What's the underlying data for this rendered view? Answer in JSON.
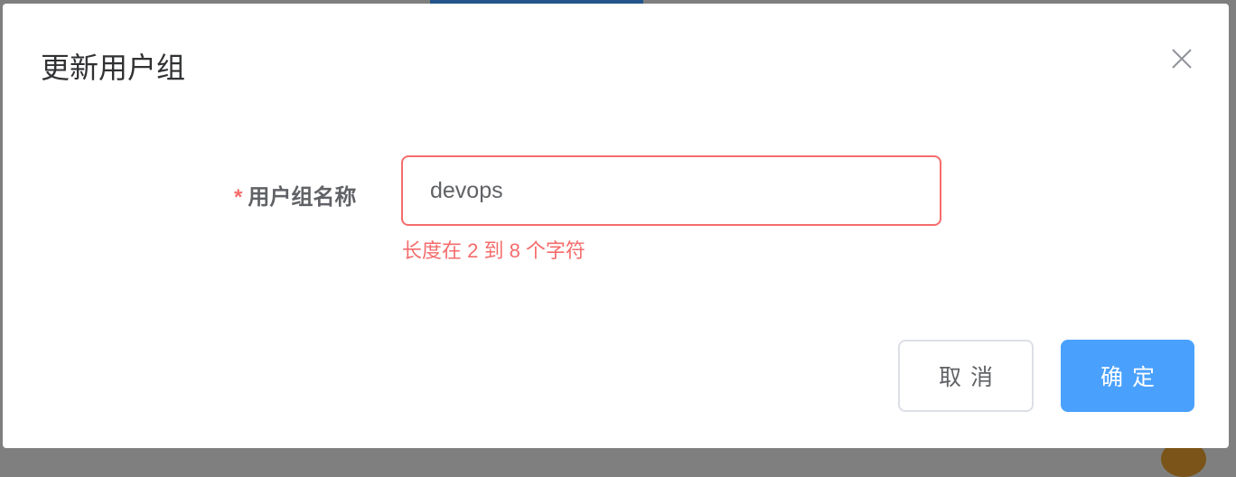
{
  "dialog": {
    "title": "更新用户组",
    "field_label": "用户组名称",
    "required_mark": "*",
    "field_value": "devops",
    "error": "长度在 2 到 8 个字符",
    "cancel_label": "取消",
    "confirm_label": "确定"
  },
  "colors": {
    "primary": "#4aa1fd",
    "error": "#f56c6c"
  }
}
